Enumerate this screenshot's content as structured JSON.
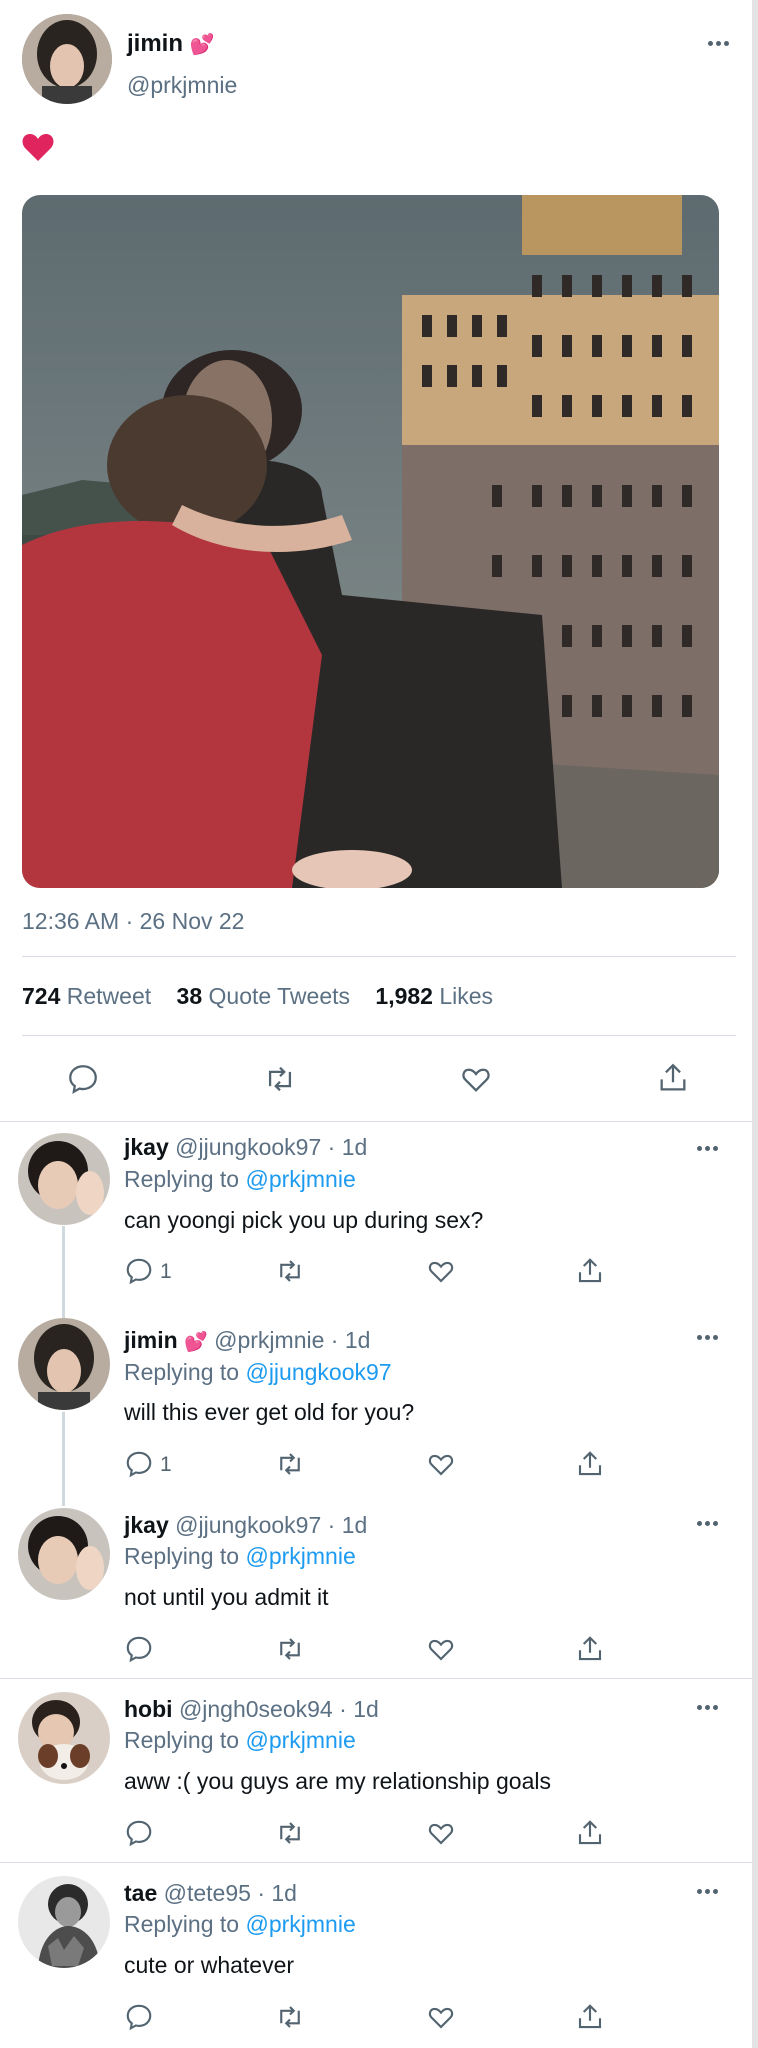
{
  "tweet": {
    "author_name": "jimin",
    "author_handle": "@prkjmnie",
    "text_emoji": "❤️",
    "timestamp": "12:36 AM · 26 Nov 22",
    "stats": [
      {
        "value": "724",
        "label": "Retweet"
      },
      {
        "value": "38",
        "label": "Quote Tweets"
      },
      {
        "value": "1,982",
        "label": "Likes"
      }
    ]
  },
  "replies": [
    {
      "name": "jkay",
      "handle": "@jjungkook97",
      "age": "1d",
      "replying_label": "Replying to",
      "replying_to": "@prkjmnie",
      "text": "can yoongi pick you up during sex?",
      "reply_count": "1"
    },
    {
      "name": "jimin",
      "handle": "@prkjmnie",
      "age": "1d",
      "replying_label": "Replying to",
      "replying_to": "@jjungkook97",
      "text": "will this ever get old for you?",
      "reply_count": "1"
    },
    {
      "name": "jkay",
      "handle": "@jjungkook97",
      "age": "1d",
      "replying_label": "Replying to",
      "replying_to": "@prkjmnie",
      "text": "not until you admit it",
      "reply_count": ""
    },
    {
      "name": "hobi",
      "handle": "@jngh0seok94",
      "age": "1d",
      "replying_label": "Replying to",
      "replying_to": "@prkjmnie",
      "text": "aww :( you guys are my relationship goals",
      "reply_count": ""
    },
    {
      "name": "tae",
      "handle": "@tete95",
      "age": "1d",
      "replying_label": "Replying to",
      "replying_to": "@prkjmnie",
      "text": "cute or whatever",
      "reply_count": ""
    }
  ],
  "colors": {
    "link": "#1d9bf0",
    "muted": "#5b7083",
    "heart": "#e0245e"
  }
}
